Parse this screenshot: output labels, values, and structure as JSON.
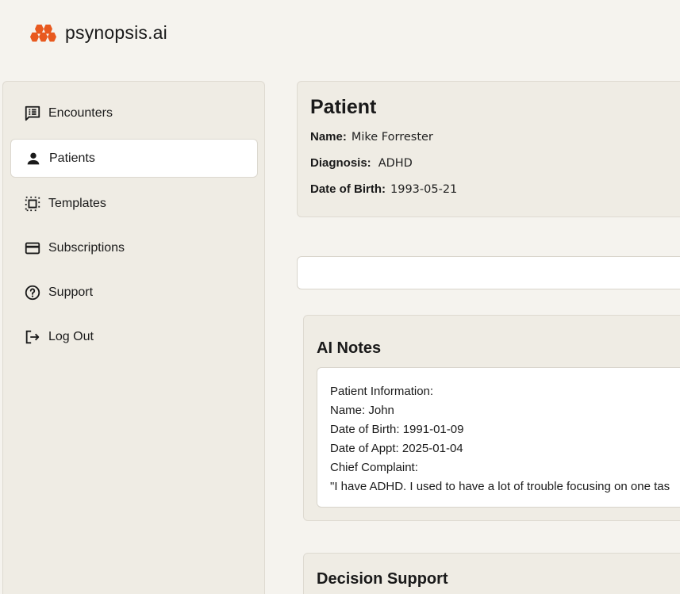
{
  "brand": {
    "name": "psynopsis.ai",
    "accent": "#e8591f"
  },
  "sidebar": {
    "items": [
      {
        "label": "Encounters",
        "icon": "chat-list-icon"
      },
      {
        "label": "Patients",
        "icon": "person-icon",
        "active": true
      },
      {
        "label": "Templates",
        "icon": "template-icon"
      },
      {
        "label": "Subscriptions",
        "icon": "credit-card-icon"
      },
      {
        "label": "Support",
        "icon": "help-circle-icon"
      },
      {
        "label": "Log Out",
        "icon": "logout-icon"
      }
    ]
  },
  "patient": {
    "title": "Patient",
    "name_label": "Name:",
    "name": "Mike Forrester",
    "diagnosis_label": "Diagnosis:",
    "diagnosis": "ADHD",
    "dob_label": "Date of Birth:",
    "dob": "1993-05-21"
  },
  "ai_notes": {
    "title": "AI Notes",
    "lines": [
      "Patient Information:",
      "Name: John",
      "Date of Birth: 1991-01-09",
      "Date of Appt: 2025-01-04",
      "Chief Complaint:",
      "\"I have ADHD. I used to have a lot of trouble focusing on one tas"
    ]
  },
  "decision_support": {
    "title": "Decision Support"
  }
}
